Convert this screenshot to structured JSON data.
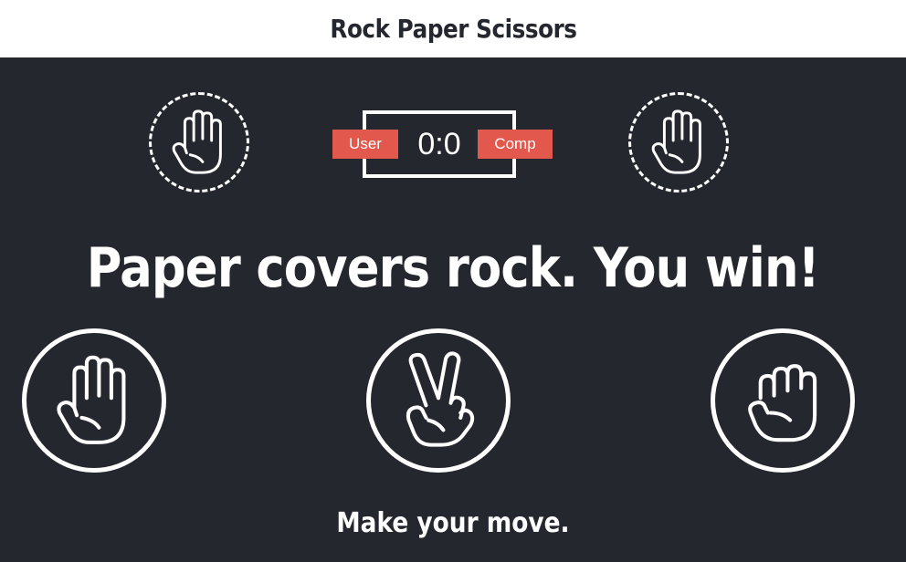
{
  "header": {
    "title": "Rock Paper Scissors"
  },
  "scoreboard": {
    "user_label": "User",
    "score": "0:0",
    "comp_label": "Comp"
  },
  "user_choice_icon": "paper-hand-icon",
  "comp_choice_icon": "paper-hand-icon",
  "result": {
    "message": "Paper covers rock. You win!"
  },
  "choices": [
    {
      "id": "paper",
      "icon": "paper-hand-icon"
    },
    {
      "id": "scissors",
      "icon": "scissors-hand-icon"
    },
    {
      "id": "rock",
      "icon": "rock-hand-icon"
    }
  ],
  "prompt": {
    "message": "Make your move."
  },
  "colors": {
    "background": "#24272e",
    "header_background": "#ffffff",
    "accent": "#e2584d",
    "foreground": "#ffffff"
  }
}
